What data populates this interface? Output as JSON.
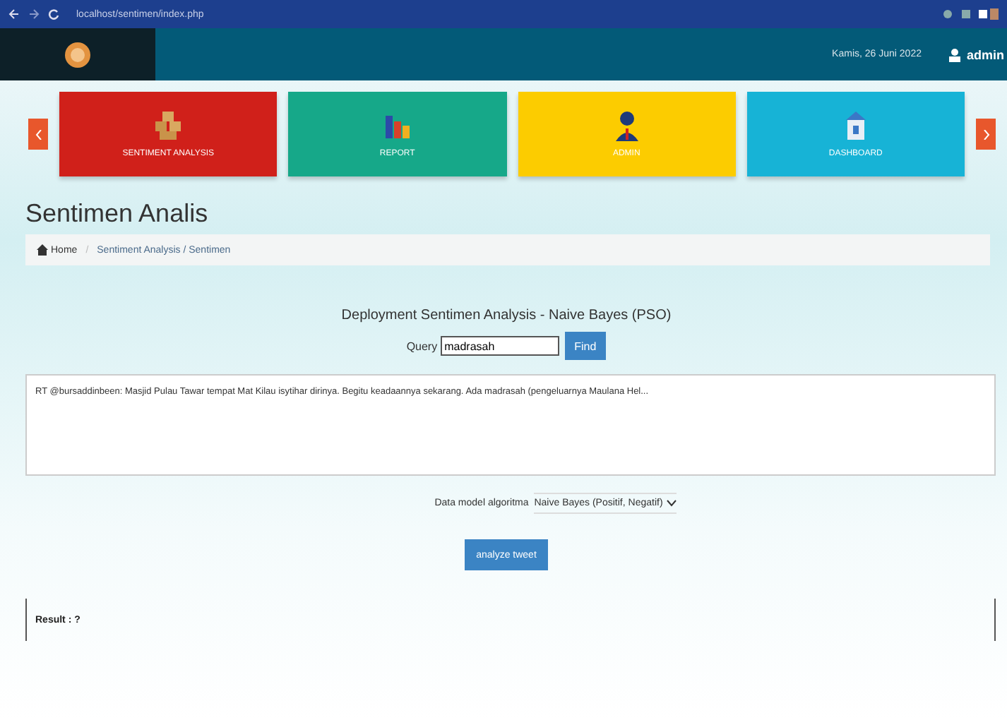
{
  "browser": {
    "url": "localhost/sentimen/index.php"
  },
  "header": {
    "date": "Kamis, 26 Juni 2022",
    "user": "admin"
  },
  "tiles": [
    {
      "label": "SENTIMENT ANALYSIS",
      "color": "#d0201a",
      "kind": "boxes"
    },
    {
      "label": "REPORT",
      "color": "#16a889",
      "kind": "chart"
    },
    {
      "label": "ADMIN",
      "color": "#fccc00",
      "kind": "person"
    },
    {
      "label": "DASHBOARD",
      "color": "#17b3d6",
      "kind": "building"
    }
  ],
  "page_title": "Sentimen Analis",
  "breadcrumb": {
    "home": "Home",
    "separator": "/",
    "path": "Sentiment Analysis / Sentimen"
  },
  "form": {
    "heading": "Deployment Sentimen Analysis - Naive Bayes (PSO)",
    "query_label": "Query",
    "query_value": "madrasah",
    "find_button": "Find",
    "tweet": "RT @bursaddinbeen: Masjid Pulau Tawar tempat Mat Kilau isytihar dirinya. Begitu keadaannya sekarang. Ada madrasah (pengeluarnya Maulana Hel...",
    "model_label": "Data model algoritma",
    "model_value": "Naive Bayes (Positif, Negatif)",
    "analyze_button": "analyze tweet"
  },
  "result": "Result : ?"
}
